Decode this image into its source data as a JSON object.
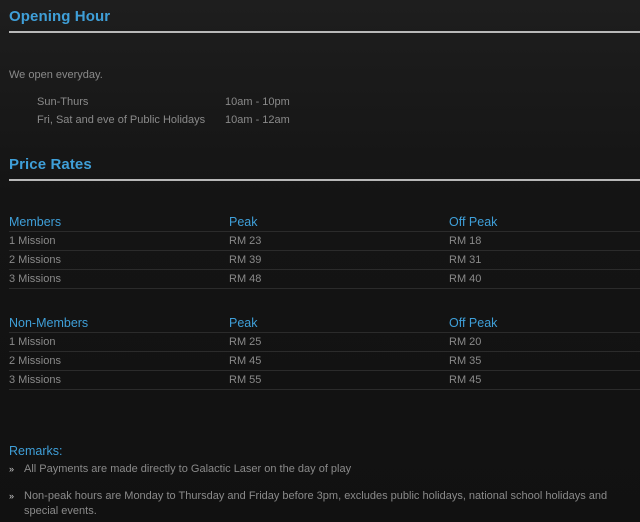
{
  "opening": {
    "title": "Opening Hour",
    "intro": "We open everyday.",
    "rows": [
      {
        "days": "Sun-Thurs",
        "hours": "10am - 10pm"
      },
      {
        "days": "Fri, Sat and eve of Public Holidays",
        "hours": "10am - 12am"
      }
    ]
  },
  "prices": {
    "title": "Price Rates",
    "members": {
      "header": [
        "Members",
        "Peak",
        "Off Peak"
      ],
      "rows": [
        [
          "1 Mission",
          "RM 23",
          "RM 18"
        ],
        [
          "2 Missions",
          "RM 39",
          "RM 31"
        ],
        [
          "3 Missions",
          "RM 48",
          "RM 40"
        ]
      ]
    },
    "non_members": {
      "header": [
        "Non-Members",
        "Peak",
        "Off Peak"
      ],
      "rows": [
        [
          "1 Mission",
          "RM 25",
          "RM 20"
        ],
        [
          "2 Missions",
          "RM 45",
          "RM 35"
        ],
        [
          "3 Missions",
          "RM 55",
          "RM 45"
        ]
      ]
    }
  },
  "remarks": {
    "title": "Remarks:",
    "bullet_glyph": "»",
    "items": [
      "All Payments are made directly to Galactic Laser on the day of play",
      "Non-peak hours are Monday to Thursday and Friday before 3pm, excludes public holidays, national school holidays and special events."
    ]
  },
  "colors": {
    "accent": "#3f9fd8",
    "text": "#8a8a8a",
    "rule": "#b8b8b8",
    "background": "#141414"
  }
}
